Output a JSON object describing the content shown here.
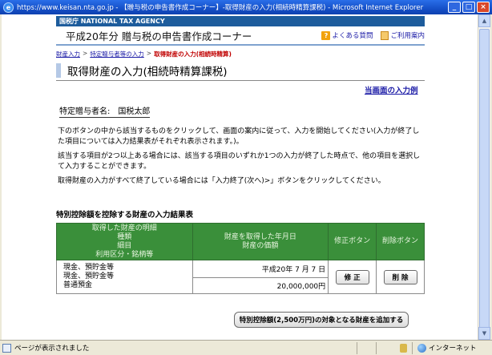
{
  "window": {
    "title": "https://www.keisan.nta.go.jp - 【贈与税の申告書作成コーナー】-取得財産の入力(相続時精算課税) - Microsoft Internet Explorer"
  },
  "header": {
    "agency": "国税庁 NATIONAL TAX AGENCY",
    "app_title": "平成20年分 贈与税の申告書作成コーナー",
    "faq_label": "よくある質問",
    "guide_label": "ご利用案内"
  },
  "breadcrumb": {
    "items": [
      "財産入力",
      "特定贈与者等の入力",
      "取得財産の入力(相続時精算)"
    ],
    "separator": ">"
  },
  "page": {
    "title": "取得財産の入力(相続時精算課税)",
    "example_link": "当画面の入力例",
    "recipient_label": "特定贈与者名:",
    "recipient_name": "国税太郎"
  },
  "instructions": [
    "下のボタンの中から該当するものをクリックして、画面の案内に従って、入力を開始してください(入力が終了した項目については入力結果表がそれぞれ表示されます。)。",
    "該当する項目が2つ以上ある場合には、該当する項目のいずれか1つの入力が終了した時点で、他の項目を選択して入力することができます。",
    "取得財産の入力がすべて終了している場合には「入力終了(次へ)>」ボタンをクリックしてください。"
  ],
  "results": {
    "section_title": "特別控除額を控除する財産の入力結果表",
    "headers": {
      "col1": [
        "取得した財産の明細",
        "種類",
        "細目",
        "利用区分・銘柄等"
      ],
      "col2": [
        "財産を取得した年月日",
        "財産の価額"
      ],
      "col3": "修正ボタン",
      "col4": "削除ボタン"
    },
    "rows": [
      {
        "items": [
          "現金、預貯金等",
          "現金、預貯金等",
          "普通預金"
        ],
        "date": "平成20年 7 月 7 日",
        "value": "20,000,000円",
        "edit_label": "修 正",
        "delete_label": "削 除"
      }
    ]
  },
  "add_button_label": "特別控除額(2,500万円)の対象となる財産を追加する",
  "status": {
    "text": "ページが表示されました",
    "zone": "インターネット"
  }
}
